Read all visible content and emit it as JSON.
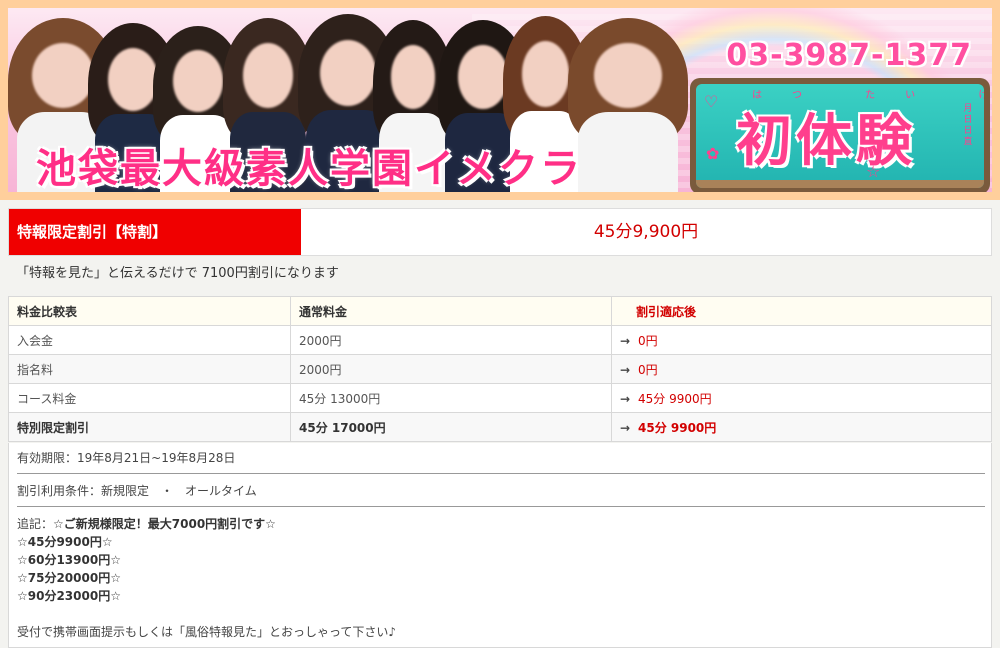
{
  "banner": {
    "title": "池袋最大級素人学園イメクラ",
    "phone": "03-3987-1377",
    "board_text": "初体験",
    "board_furigana": "はつ たい けん",
    "board_date": "月日日直"
  },
  "promo": {
    "label": "特報限定割引【特割】",
    "price": "45分9,900円",
    "note": "「特報を見た」と伝えるだけで 7100円割引になります"
  },
  "table": {
    "headers": [
      "料金比較表",
      "通常料金",
      "割引適応後"
    ],
    "arrow": "→",
    "rows": [
      {
        "name": "入会金",
        "normal": "2000円",
        "after": "0円"
      },
      {
        "name": "指名料",
        "normal": "2000円",
        "after": "0円"
      },
      {
        "name": "コース料金",
        "normal": "45分 13000円",
        "after": "45分 9900円"
      },
      {
        "name": "特別限定割引",
        "normal": "45分 17000円",
        "after": "45分 9900円"
      }
    ]
  },
  "info": {
    "validity": "有効期限：19年8月21日~19年8月28日",
    "conditions": "割引利用条件：新規限定　・　オールタイム",
    "note_prefix": "追記：",
    "note_lines": [
      "☆ご新規様限定！最大7000円割引です☆",
      "☆45分9900円☆",
      "☆60分13900円☆",
      "☆75分20000円☆",
      "☆90分23000円☆"
    ],
    "footer": "受付で携帯画面提示もしくは「風俗特報見た」とおっしゃって下さい♪"
  }
}
